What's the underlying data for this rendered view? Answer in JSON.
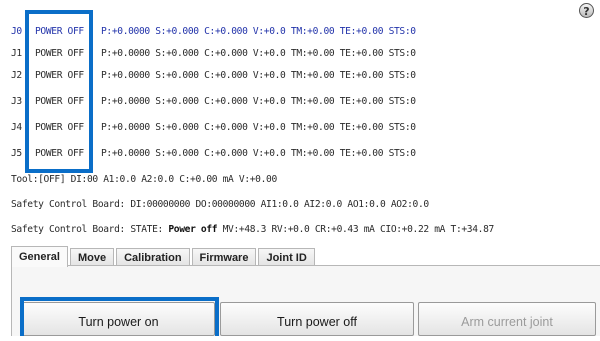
{
  "help": {
    "icon": "question-mark-icon",
    "glyph": "?"
  },
  "joints": [
    {
      "id": "J0",
      "state": "POWER OFF",
      "readout": "P:+0.0000 S:+0.000 C:+0.000 V:+0.0 TM:+0.00 TE:+0.00 STS:0"
    },
    {
      "id": "J1",
      "state": "POWER OFF",
      "readout": "P:+0.0000 S:+0.000 C:+0.000 V:+0.0 TM:+0.00 TE:+0.00 STS:0"
    },
    {
      "id": "J2",
      "state": "POWER OFF",
      "readout": "P:+0.0000 S:+0.000 C:+0.000 V:+0.0 TM:+0.00 TE:+0.00 STS:0"
    },
    {
      "id": "J3",
      "state": "POWER OFF",
      "readout": "P:+0.0000 S:+0.000 C:+0.000 V:+0.0 TM:+0.00 TE:+0.00 STS:0"
    },
    {
      "id": "J4",
      "state": "POWER OFF",
      "readout": "P:+0.0000 S:+0.000 C:+0.000 V:+0.0 TM:+0.00 TE:+0.00 STS:0"
    },
    {
      "id": "J5",
      "state": "POWER OFF",
      "readout": "P:+0.0000 S:+0.000 C:+0.000 V:+0.0 TM:+0.00 TE:+0.00 STS:0"
    }
  ],
  "tool_line": "Tool:[OFF] DI:00  A1:0.0 A2:0.0 C:+0.00 mA V:+0.00",
  "safety_io_line": "Safety Control Board: DI:00000000 DO:00000000 AI1:0.0 AI2:0.0 AO1:0.0 AO2:0.0",
  "safety_state": {
    "prefix": "Safety Control Board: STATE: ",
    "state": "Power off",
    "suffix": " MV:+48.3 RV:+0.0 CR:+0.43 mA CIO:+0.22 mA T:+34.87"
  },
  "tabs": [
    "General",
    "Move",
    "Calibration",
    "Firmware",
    "Joint ID"
  ],
  "buttons": {
    "power_on": "Turn power on",
    "power_off": "Turn power off",
    "arm_joint": "Arm current joint"
  },
  "colors": {
    "highlight": "#0a6ec8",
    "first_row_text": "#2233aa",
    "disabled_text": "#9b9b9b"
  }
}
